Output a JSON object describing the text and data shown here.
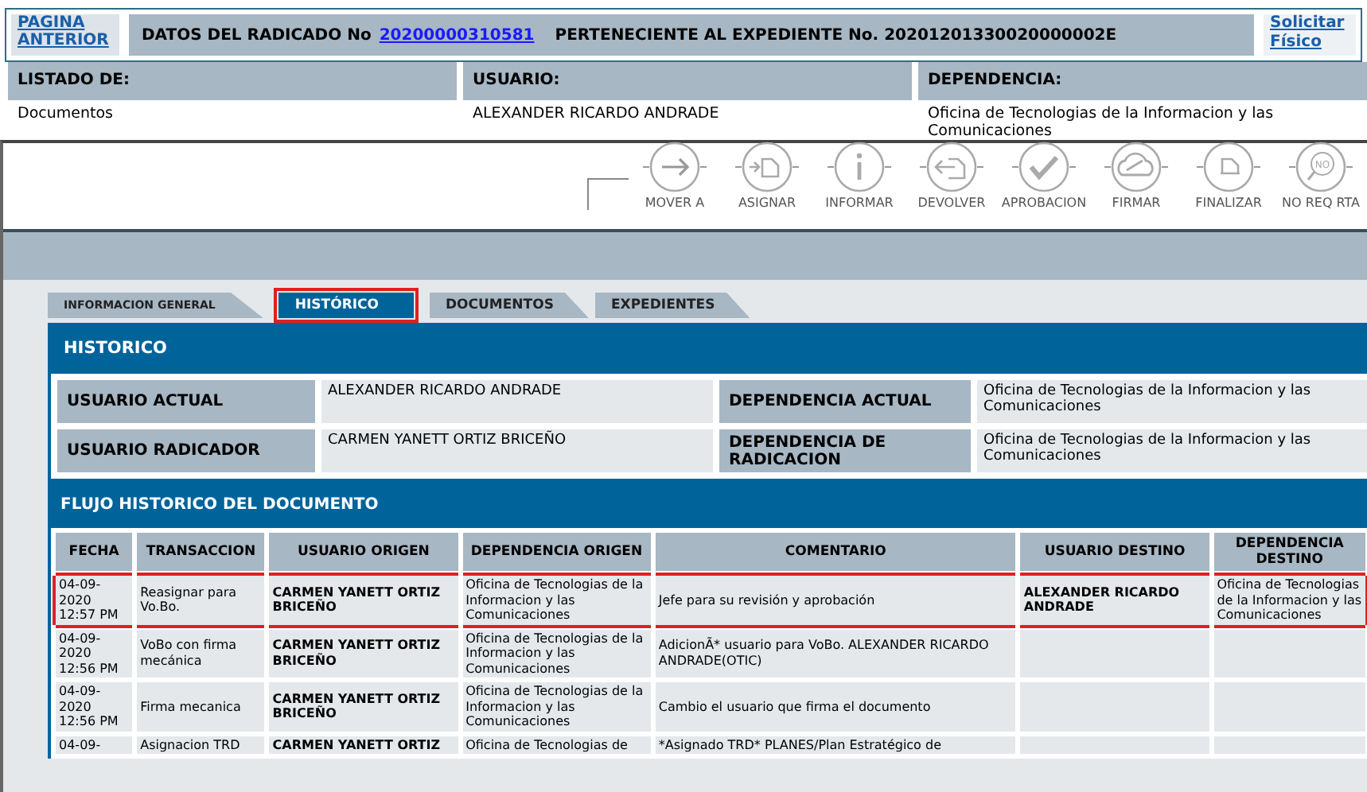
{
  "top_bar": {
    "back_link": "PAGINA ANTERIOR",
    "radicado_label": "DATOS DEL RADICADO No",
    "radicado_number": "20200000310581",
    "expediente_text": "PERTENECIENTE AL EXPEDIENTE No. 20201201330020000002E",
    "request_link": "Solicitar Físico"
  },
  "summary": [
    {
      "label": "LISTADO DE:",
      "value": "Documentos"
    },
    {
      "label": "USUARIO:",
      "value": "ALEXANDER RICARDO ANDRADE"
    },
    {
      "label": "DEPENDENCIA:",
      "value": "Oficina de Tecnologias de la Informacion y las Comunicaciones"
    }
  ],
  "actions": [
    {
      "kind": "move",
      "label": "MOVER A"
    },
    {
      "kind": "assign",
      "label": "ASIGNAR"
    },
    {
      "kind": "inform",
      "label": "INFORMAR"
    },
    {
      "kind": "return",
      "label": "DEVOLVER"
    },
    {
      "kind": "approve",
      "label": "APROBACION"
    },
    {
      "kind": "sign",
      "label": "FIRMAR"
    },
    {
      "kind": "finish",
      "label": "FINALIZAR"
    },
    {
      "kind": "noreply",
      "label": "NO REQ RTA",
      "icon_text": "NO"
    }
  ],
  "tabs": [
    {
      "label": "INFORMACION GENERAL",
      "selected": false
    },
    {
      "label": "HISTÓRICO",
      "selected": true
    },
    {
      "label": "DOCUMENTOS",
      "selected": false
    },
    {
      "label": "EXPEDIENTES",
      "selected": false
    }
  ],
  "historico": {
    "title": "HISTORICO",
    "fields": [
      {
        "label": "USUARIO ACTUAL",
        "value": "ALEXANDER RICARDO ANDRADE"
      },
      {
        "label": "DEPENDENCIA ACTUAL",
        "value": "Oficina de Tecnologias de la Informacion y las Comunicaciones"
      },
      {
        "label": "USUARIO RADICADOR",
        "value": "CARMEN YANETT ORTIZ BRICEÑO"
      },
      {
        "label": "DEPENDENCIA DE RADICACION",
        "value": "Oficina de Tecnologias de la Informacion y las Comunicaciones"
      }
    ]
  },
  "flujo": {
    "title": "FLUJO HISTORICO DEL DOCUMENTO",
    "columns": [
      "FECHA",
      "TRANSACCION",
      "USUARIO ORIGEN",
      "DEPENDENCIA ORIGEN",
      "COMENTARIO",
      "USUARIO DESTINO",
      "DEPENDENCIA DESTINO"
    ],
    "rows": [
      {
        "highlighted": true,
        "cells": [
          "04-09-2020 12:57 PM",
          "Reasignar para Vo.Bo.",
          "CARMEN YANETT ORTIZ BRICEÑO",
          "Oficina de Tecnologias de la Informacion y las Comunicaciones",
          "Jefe para su revisión y aprobación",
          "ALEXANDER RICARDO ANDRADE",
          "Oficina de Tecnologias de la Informacion y las Comunicaciones"
        ]
      },
      {
        "highlighted": false,
        "cells": [
          "04-09-2020 12:56 PM",
          "VoBo con firma mecánica",
          "CARMEN YANETT ORTIZ BRICEÑO",
          "Oficina de Tecnologias de la Informacion y las Comunicaciones",
          "AdicionÃ* usuario para VoBo. ALEXANDER RICARDO ANDRADE(OTIC)",
          "",
          ""
        ]
      },
      {
        "highlighted": false,
        "cells": [
          "04-09-2020 12:56 PM",
          "Firma mecanica",
          "CARMEN YANETT ORTIZ BRICEÑO",
          "Oficina de Tecnologias de la Informacion y las Comunicaciones",
          "Cambio el usuario que firma el documento",
          "",
          ""
        ]
      },
      {
        "highlighted": false,
        "cells": [
          "04-09-",
          "Asignacion TRD",
          "CARMEN YANETT ORTIZ",
          "Oficina de Tecnologias de",
          "*Asignado TRD* PLANES/Plan Estratégico de",
          "",
          ""
        ]
      }
    ]
  }
}
